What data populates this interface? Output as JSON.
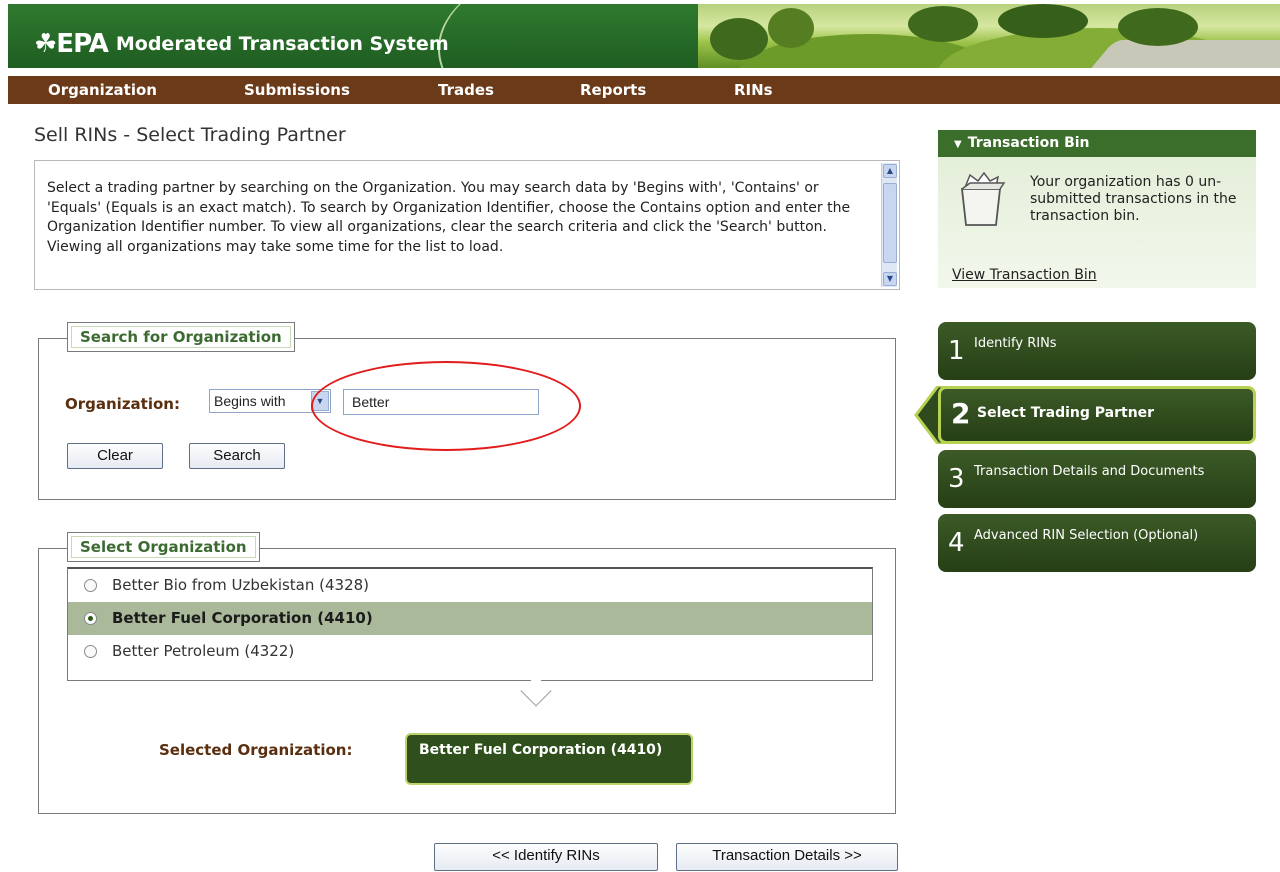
{
  "header": {
    "logo_mark": "☘EPA",
    "app_title": "Moderated Transaction System"
  },
  "nav": {
    "items": [
      {
        "label": "Organization"
      },
      {
        "label": "Submissions"
      },
      {
        "label": "Trades"
      },
      {
        "label": "Reports"
      },
      {
        "label": "RINs"
      }
    ]
  },
  "page": {
    "title": "Sell RINs - Select Trading Partner",
    "instructions": "Select a trading partner by searching on the Organization. You may search data by 'Begins with', 'Contains' or 'Equals' (Equals is an exact match). To search by Organization Identifier, choose the Contains option and enter the Organization Identifier number. To view all organizations, clear the search criteria and click the 'Search' button. Viewing all organizations may take some time for the list to load."
  },
  "search": {
    "legend": "Search for Organization",
    "org_label": "Organization:",
    "match_mode": "Begins with",
    "query": "Better",
    "clear_label": "Clear",
    "search_label": "Search"
  },
  "select": {
    "legend": "Select Organization",
    "organizations": [
      {
        "name": "Better Bio from Uzbekistan (4328)",
        "selected": false
      },
      {
        "name": "Better Fuel Corporation (4410)",
        "selected": true
      },
      {
        "name": "Better Petroleum (4322)",
        "selected": false
      }
    ],
    "selected_label": "Selected Organization:",
    "selected_value": "Better Fuel Corporation (4410)"
  },
  "footer_nav": {
    "back_label": "<< Identify RINs",
    "next_label": "Transaction Details >>"
  },
  "sidebar": {
    "bin_title": "Transaction Bin",
    "bin_text": "Your organization has 0 un-submitted transactions in the transaction bin.",
    "bin_link": "View Transaction Bin",
    "steps": [
      {
        "number": "1",
        "label": "Identify RINs"
      },
      {
        "number": "2",
        "label": "Select Trading Partner"
      },
      {
        "number": "3",
        "label": "Transaction Details and Documents"
      },
      {
        "number": "4",
        "label": "Advanced RIN Selection (Optional)"
      }
    ],
    "active_step": 2
  },
  "colors": {
    "header_green": "#2f7a2f",
    "nav_brown": "#6b3a18",
    "step_green": "#2f4f1c",
    "active_outline": "#b7d253",
    "highlight_ring": "#e21b1b",
    "selected_row": "#a9b99a"
  }
}
